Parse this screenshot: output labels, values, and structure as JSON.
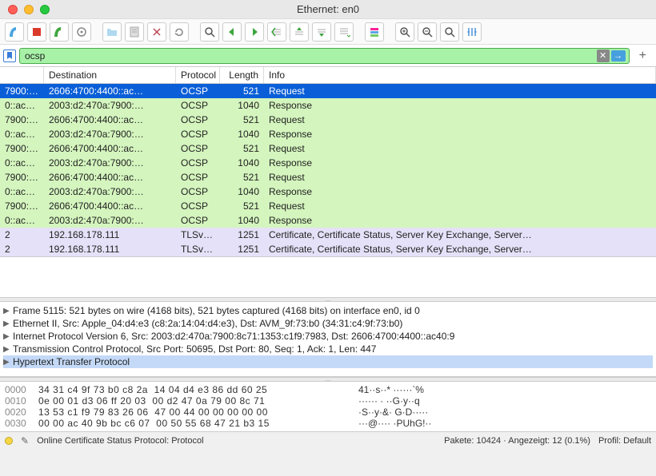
{
  "window": {
    "title": "Ethernet: en0"
  },
  "filter": {
    "value": "ocsp"
  },
  "columns": {
    "src": "",
    "dst": "Destination",
    "pro": "Protocol",
    "len": "Length",
    "info": "Info"
  },
  "packets": [
    {
      "src": "7900:…",
      "dst": "2606:4700:4400::ac…",
      "pro": "OCSP",
      "len": "521",
      "info": "Request",
      "cls": "sel"
    },
    {
      "src": "0::ac…",
      "dst": "2003:d2:470a:7900:…",
      "pro": "OCSP",
      "len": "1040",
      "info": "Response",
      "cls": "grn"
    },
    {
      "src": "7900:…",
      "dst": "2606:4700:4400::ac…",
      "pro": "OCSP",
      "len": "521",
      "info": "Request",
      "cls": "grn"
    },
    {
      "src": "0::ac…",
      "dst": "2003:d2:470a:7900:…",
      "pro": "OCSP",
      "len": "1040",
      "info": "Response",
      "cls": "grn"
    },
    {
      "src": "7900:…",
      "dst": "2606:4700:4400::ac…",
      "pro": "OCSP",
      "len": "521",
      "info": "Request",
      "cls": "grn"
    },
    {
      "src": "0::ac…",
      "dst": "2003:d2:470a:7900:…",
      "pro": "OCSP",
      "len": "1040",
      "info": "Response",
      "cls": "grn"
    },
    {
      "src": "7900:…",
      "dst": "2606:4700:4400::ac…",
      "pro": "OCSP",
      "len": "521",
      "info": "Request",
      "cls": "grn"
    },
    {
      "src": "0::ac…",
      "dst": "2003:d2:470a:7900:…",
      "pro": "OCSP",
      "len": "1040",
      "info": "Response",
      "cls": "grn"
    },
    {
      "src": "7900:…",
      "dst": "2606:4700:4400::ac…",
      "pro": "OCSP",
      "len": "521",
      "info": "Request",
      "cls": "grn"
    },
    {
      "src": "0::ac…",
      "dst": "2003:d2:470a:7900:…",
      "pro": "OCSP",
      "len": "1040",
      "info": "Response",
      "cls": "grn"
    },
    {
      "src": "2",
      "dst": "192.168.178.111",
      "pro": "TLSv1…",
      "len": "1251",
      "info": "Certificate, Certificate Status, Server Key Exchange, Server…",
      "cls": "lav"
    },
    {
      "src": "2",
      "dst": "192.168.178.111",
      "pro": "TLSv1…",
      "len": "1251",
      "info": "Certificate, Certificate Status, Server Key Exchange, Server…",
      "cls": "lav"
    }
  ],
  "tree": [
    {
      "t": "Frame 5115: 521 bytes on wire (4168 bits), 521 bytes captured (4168 bits) on interface en0, id 0",
      "hl": false
    },
    {
      "t": "Ethernet II, Src: Apple_04:d4:e3 (c8:2a:14:04:d4:e3), Dst: AVM_9f:73:b0 (34:31:c4:9f:73:b0)",
      "hl": false
    },
    {
      "t": "Internet Protocol Version 6, Src: 2003:d2:470a:7900:8c71:1353:c1f9:7983, Dst: 2606:4700:4400::ac40:9",
      "hl": false
    },
    {
      "t": "Transmission Control Protocol, Src Port: 50695, Dst Port: 80, Seq: 1, Ack: 1, Len: 447",
      "hl": false
    },
    {
      "t": "Hypertext Transfer Protocol",
      "hl": true
    }
  ],
  "hex": [
    {
      "off": "0000",
      "b": "34 31 c4 9f 73 b0 c8 2a  14 04 d4 e3 86 dd 60 25",
      "a": "41··s··* ······`%"
    },
    {
      "off": "0010",
      "b": "0e 00 01 d3 06 ff 20 03  00 d2 47 0a 79 00 8c 71",
      "a": "······ · ··G·y··q"
    },
    {
      "off": "0020",
      "b": "13 53 c1 f9 79 83 26 06  47 00 44 00 00 00 00 00",
      "a": "·S··y·&· G·D·····"
    },
    {
      "off": "0030",
      "b": "00 00 ac 40 9b bc c6 07  00 50 55 68 47 21 b3 15",
      "a": "···@···· ·PUhG!··"
    }
  ],
  "status": {
    "left": "Online Certificate Status Protocol: Protocol",
    "mid": "Pakete: 10424 · Angezeigt: 12 (0.1%)",
    "right": "Profil: Default"
  }
}
